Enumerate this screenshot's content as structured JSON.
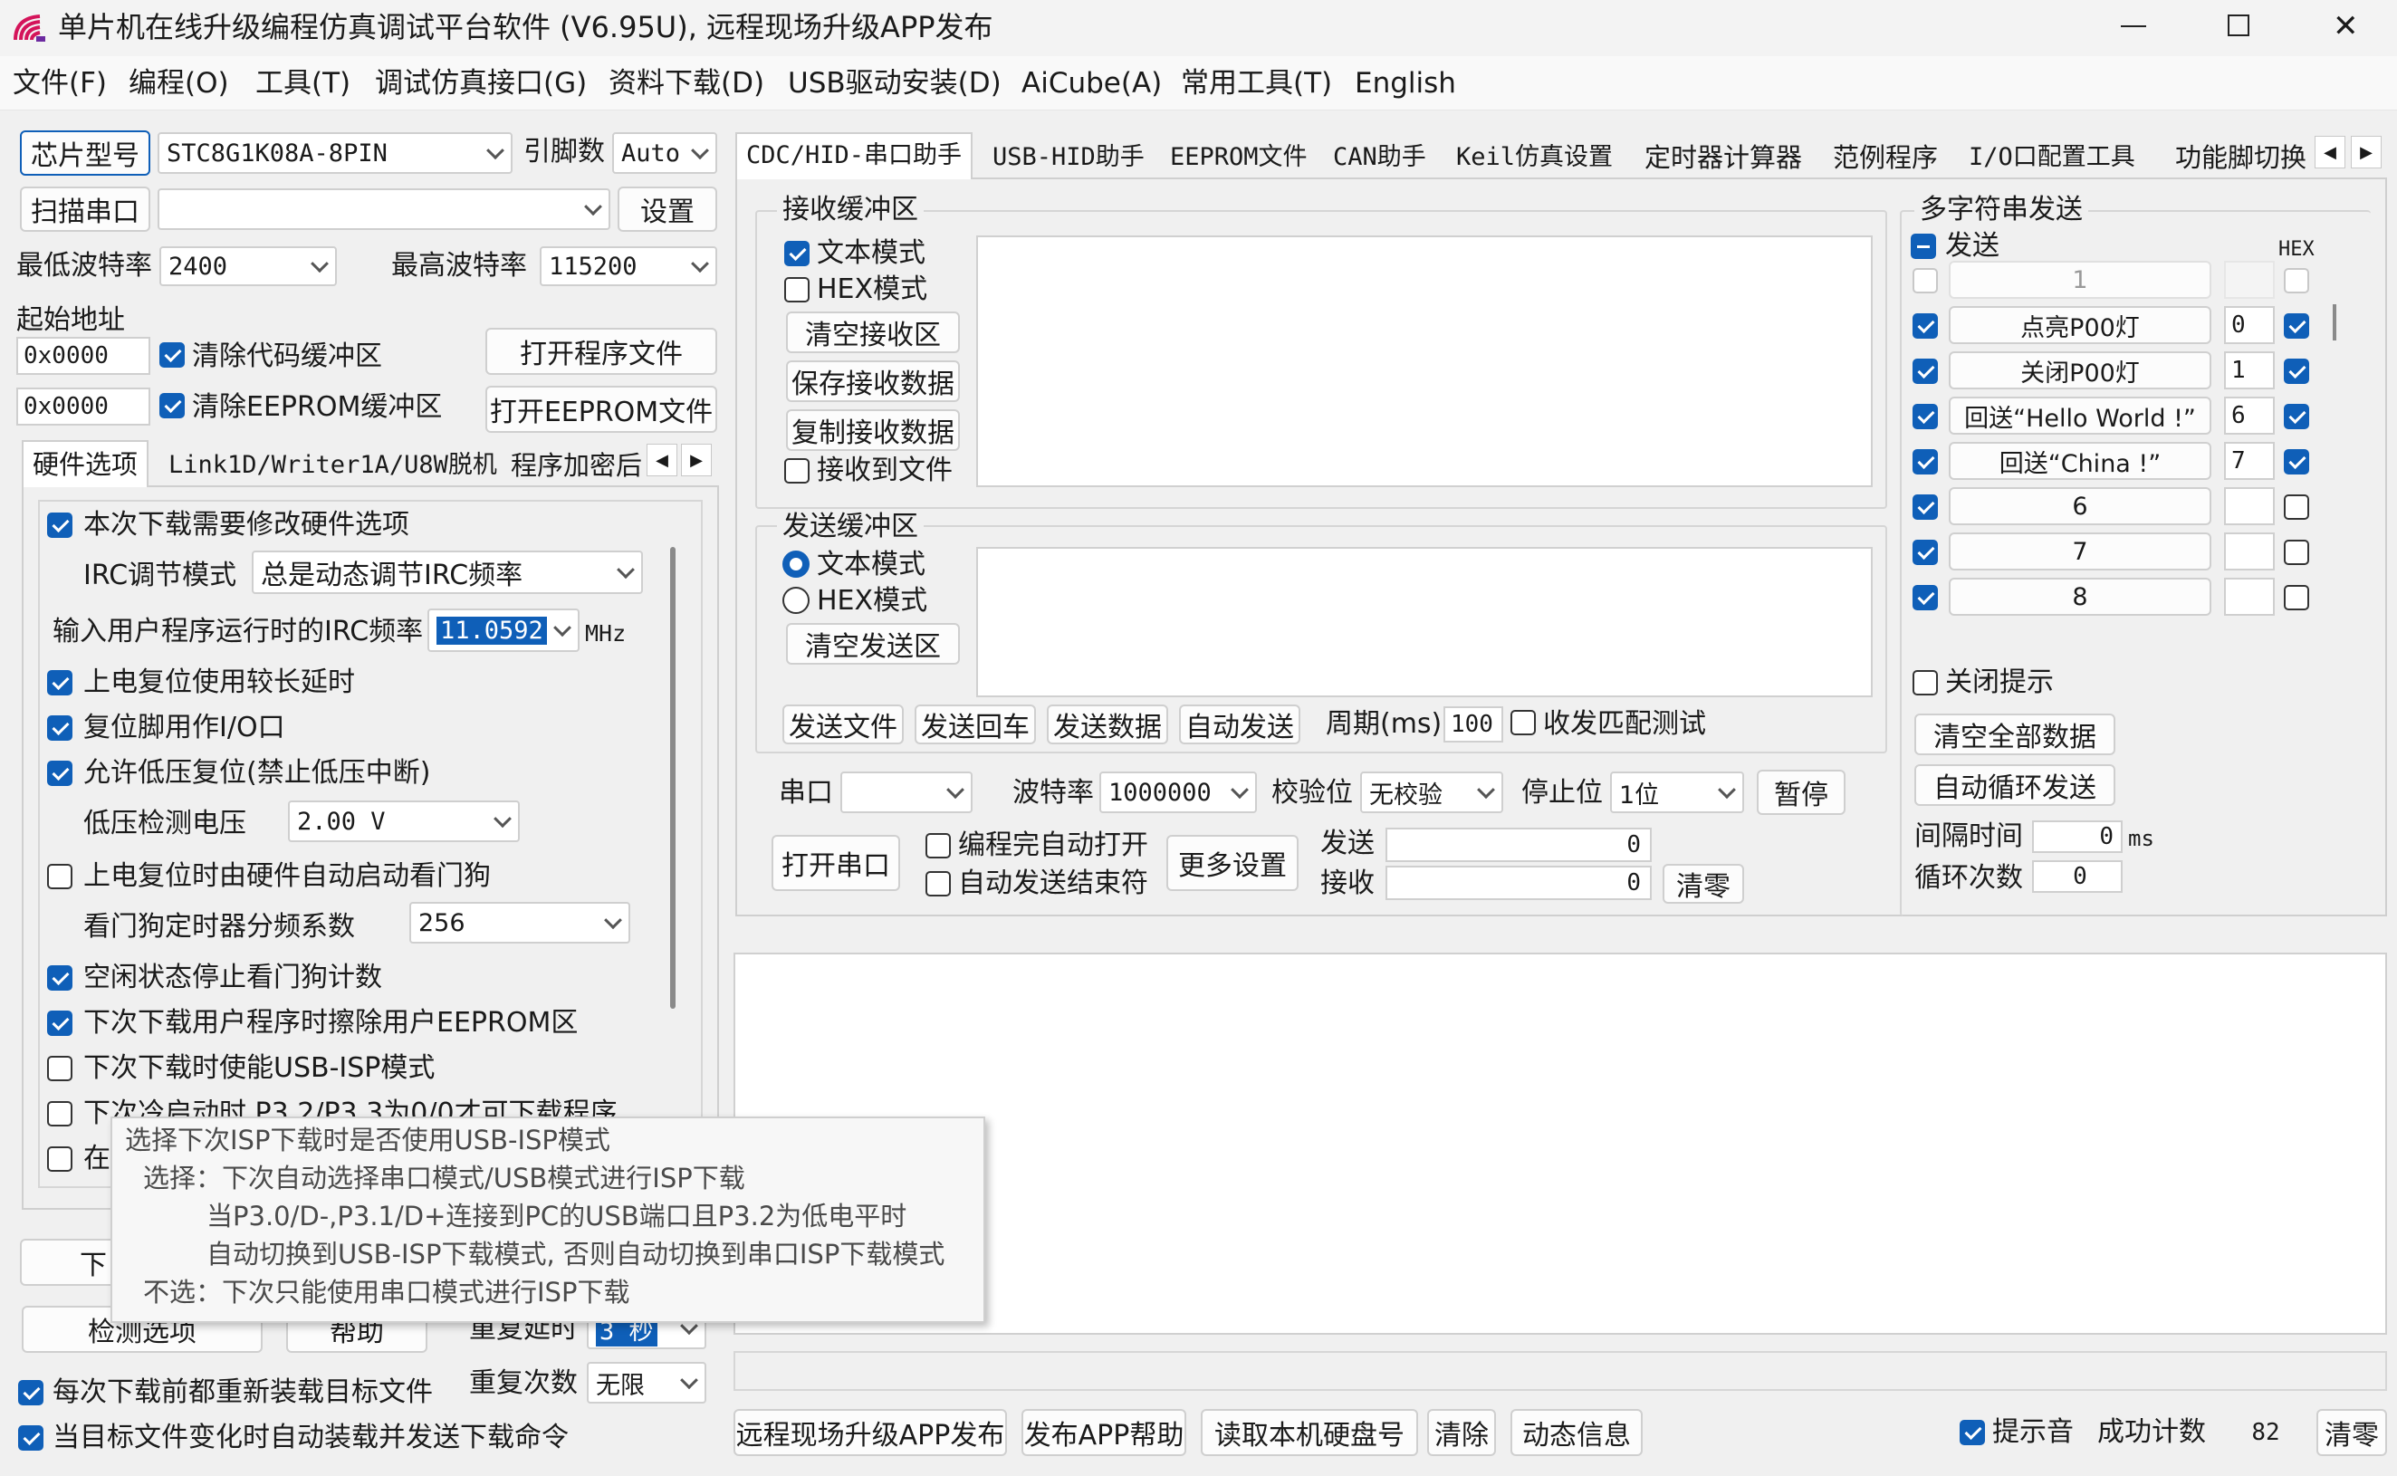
{
  "window": {
    "title": "单片机在线升级编程仿真调试平台软件 (V6.95U), 远程现场升级APP发布"
  },
  "menu": [
    "文件(F)",
    "编程(O)",
    "工具(T)",
    "调试仿真接口(G)",
    "资料下载(D)",
    "USB驱动安装(D)",
    "AiCube(A)",
    "常用工具(T)",
    "English"
  ],
  "left": {
    "chip_btn": "芯片型号",
    "chip_value": "STC8G1K08A-8PIN",
    "pin_label": "引脚数",
    "pin_value": "Auto",
    "scan_btn": "扫描串口",
    "port_value": "",
    "settings_btn": "设置",
    "min_baud_label": "最低波特率",
    "min_baud": "2400",
    "max_baud_label": "最高波特率",
    "max_baud": "115200",
    "start_addr_label": "起始地址",
    "addr1": "0x0000",
    "clear_code": "清除代码缓冲区",
    "open_prog": "打开程序文件",
    "addr2": "0x0000",
    "clear_eeprom": "清除EEPROM缓冲区",
    "open_eeprom": "打开EEPROM文件",
    "tabs": [
      "硬件选项",
      "Link1D/Writer1A/U8W脱机",
      "程序加密后"
    ],
    "opts": {
      "modify_hw": "本次下载需要修改硬件选项",
      "irc_mode_label": "IRC调节模式",
      "irc_mode": "总是动态调节IRC频率",
      "irc_freq_label": "输入用户程序运行时的IRC频率",
      "irc_freq": "11.0592",
      "mhz": "MHz",
      "long_delay": "上电复位使用较长延时",
      "reset_io": "复位脚用作I/O口",
      "low_volt": "允许低压复位(禁止低压中断)",
      "lv_label": "低压检测电压",
      "lv_value": "2.00 V",
      "wdt_auto": "上电复位时由硬件自动启动看门狗",
      "wdt_div_label": "看门狗定时器分频系数",
      "wdt_div": "256",
      "idle_wdt": "空闲状态停止看门狗计数",
      "erase_eeprom": "下次下载用户程序时擦除用户EEPROM区",
      "usb_isp": "下次下载时使能USB-ISP模式",
      "p32": "下次冷启动时 P3.2/P3.3为0/0才可下载程序",
      "row10": "在"
    },
    "download_btn": "下",
    "check_btn": "检测选项",
    "help_btn": "帮助",
    "repeat_delay_label": "重复延时",
    "repeat_delay": "3 秒",
    "repeat_count_label": "重复次数",
    "repeat_count": "无限",
    "reload": "每次下载前都重新装载目标文件",
    "auto_send": "当目标文件变化时自动装载并发送下载命令"
  },
  "tooltip": [
    "选择下次ISP下载时是否使用USB-ISP模式",
    "选择：下次自动选择串口模式/USB模式进行ISP下载",
    "当P3.0/D-,P3.1/D+连接到PC的USB端口且P3.2为低电平时",
    "自动切换到USB-ISP下载模式, 否则自动切换到串口ISP下载模式",
    "不选：下次只能使用串口模式进行ISP下载"
  ],
  "right_tabs": [
    "CDC/HID-串口助手",
    "USB-HID助手",
    "EEPROM文件",
    "CAN助手",
    "Keil仿真设置",
    "定时器计算器",
    "范例程序",
    "I/O口配置工具",
    "功能脚切换"
  ],
  "serial": {
    "recv_title": "接收缓冲区",
    "text_mode": "文本模式",
    "hex_mode": "HEX模式",
    "clear_recv": "清空接收区",
    "save_recv": "保存接收数据",
    "copy_recv": "复制接收数据",
    "recv_file": "接收到文件",
    "send_title": "发送缓冲区",
    "clear_send": "清空发送区",
    "send_file": "发送文件",
    "send_cr": "发送回车",
    "send_data": "发送数据",
    "auto_send": "自动发送",
    "period_label": "周期(ms)",
    "period": "100",
    "match_test": "收发匹配测试",
    "port_label": "串口",
    "port": "",
    "baud_label": "波特率",
    "baud": "1000000",
    "parity_label": "校验位",
    "parity": "无校验",
    "stop_label": "停止位",
    "stop": "1位",
    "pause": "暂停",
    "open_port": "打开串口",
    "auto_open": "编程完自动打开",
    "auto_end": "自动发送结束符",
    "more": "更多设置",
    "tx_label": "发送",
    "tx": "0",
    "rx_label": "接收",
    "rx": "0",
    "clear": "清零"
  },
  "multi": {
    "title": "多字符串发送",
    "send": "发送",
    "hex": "HEX",
    "rows": [
      {
        "text": "1",
        "num": "",
        "chk": false,
        "hex": false,
        "dis": true
      },
      {
        "text": "点亮P00灯",
        "num": "0",
        "chk": true,
        "hex": true,
        "dis": false
      },
      {
        "text": "关闭P00灯",
        "num": "1",
        "chk": true,
        "hex": true,
        "dis": false
      },
      {
        "text": "回送“Hello World !”",
        "num": "6",
        "chk": true,
        "hex": true,
        "dis": false
      },
      {
        "text": "回送“China !”",
        "num": "7",
        "chk": true,
        "hex": true,
        "dis": false
      },
      {
        "text": "6",
        "num": "",
        "chk": true,
        "hex": false,
        "dis": false
      },
      {
        "text": "7",
        "num": "",
        "chk": true,
        "hex": false,
        "dis": false
      },
      {
        "text": "8",
        "num": "",
        "chk": true,
        "hex": false,
        "dis": false
      }
    ],
    "close_tip": "关闭提示",
    "clear_all": "清空全部数据",
    "auto_loop": "自动循环发送",
    "interval_label": "间隔时间",
    "interval": "0",
    "ms": "ms",
    "loop_label": "循环次数",
    "loop": "0"
  },
  "bottom": {
    "remote": "远程现场升级APP发布",
    "app_help": "发布APP帮助",
    "read_disk": "读取本机硬盘号",
    "clear": "清除",
    "dynamic": "动态信息",
    "beep": "提示音",
    "success_label": "成功计数",
    "success": "82",
    "reset": "清零"
  }
}
